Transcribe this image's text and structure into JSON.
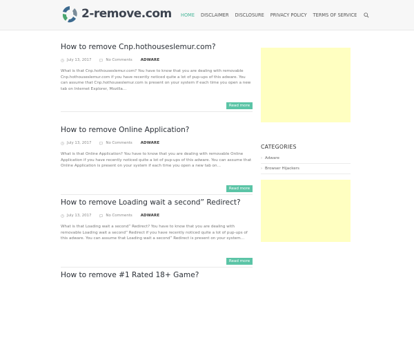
{
  "site": {
    "name": "2-remove.com",
    "brand_colors": {
      "blue": "#3d6a8f",
      "green": "#4aa56f",
      "accent": "#5bc4a6",
      "ad_bg": "#ffffc1"
    }
  },
  "nav": {
    "items": [
      {
        "label": "HOME",
        "active": true
      },
      {
        "label": "DISCLAIMER"
      },
      {
        "label": "DISCLOSURE"
      },
      {
        "label": "PRIVACY POLICY"
      },
      {
        "label": "TERMS OF SERVICE"
      }
    ],
    "search_icon": "search-icon"
  },
  "posts": [
    {
      "title": "How to remove Cnp.hothouseslemur.com?",
      "date": "July 13, 2017",
      "comments": "No Comments",
      "category": "ADWARE",
      "excerpt": "What is that Cnp.hothouseslemur.com? You have to know that you are dealing with removable Cnp.hothouseslemur.com if you have recently noticed quite a lot of pup-ups of this adware. You can assume that Cnp.hothouseslemur.com is present on your system if each time you open a new tab on Internet Explorer, Mozilla…",
      "read_more": "Read more"
    },
    {
      "title": "How to remove Online Application?",
      "date": "July 13, 2017",
      "comments": "No Comments",
      "category": "ADWARE",
      "excerpt": "What is that Online Application? You have to know that you are dealing with removable Online Application if you have recently noticed quite a lot of pup-ups of this adware. You can assume that Online Application is present on your system if each time you open a new tab on…",
      "read_more": "Read more"
    },
    {
      "title": "How to remove Loading wait a second” Redirect?",
      "date": "July 13, 2017",
      "comments": "No Comments",
      "category": "ADWARE",
      "excerpt": "What is that Loading wait a second” Redirect? You have to know that you are dealing with removable Loading wait a second” Redirect if you have recently noticed quite a lot of pup-ups of this adware. You can assume that Loading wait a second” Redirect is present on your system…",
      "read_more": "Read more"
    },
    {
      "title": "How to remove #1 Rated 18+ Game?"
    }
  ],
  "sidebar": {
    "categories_title": "CATEGORIES",
    "categories": [
      "Adware",
      "Browser Hijackers"
    ]
  }
}
